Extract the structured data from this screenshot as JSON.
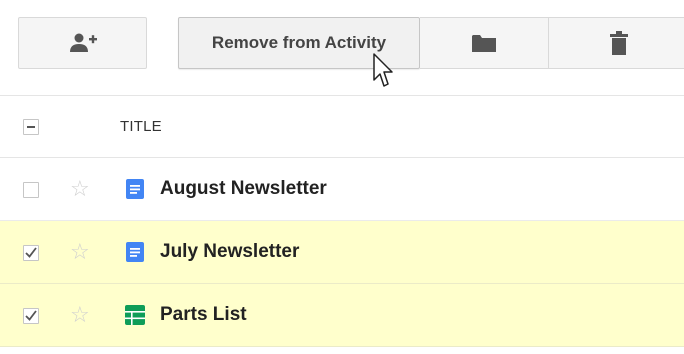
{
  "toolbar": {
    "add_icon": "add-person-icon",
    "remove_label": "Remove from Activity",
    "folder_icon": "folder-icon",
    "trash_icon": "trash-icon"
  },
  "list": {
    "header_title": "TITLE",
    "rows": [
      {
        "title": "August Newsletter",
        "checked": false,
        "starred": false,
        "file_type": "document",
        "icon_color": "#4285f4"
      },
      {
        "title": "July Newsletter",
        "checked": true,
        "starred": false,
        "file_type": "document",
        "icon_color": "#4285f4"
      },
      {
        "title": "Parts List",
        "checked": true,
        "starred": false,
        "file_type": "spreadsheet",
        "icon_color": "#0f9d58"
      }
    ]
  },
  "colors": {
    "selected_row_bg": "#ffffcc",
    "button_bg": "#f5f5f5",
    "icon_gray": "#555555"
  }
}
